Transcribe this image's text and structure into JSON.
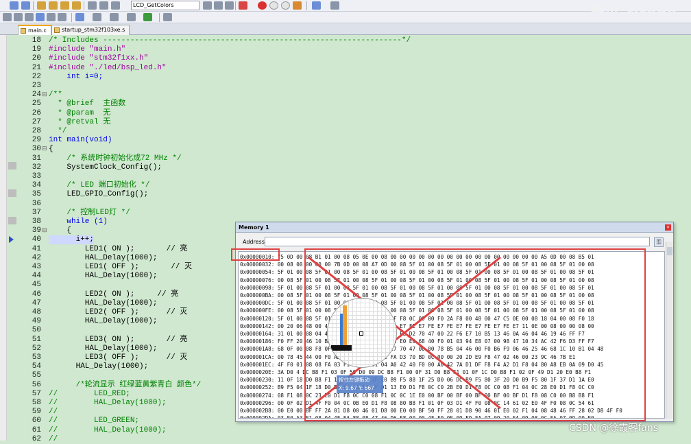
{
  "toolbar": {
    "function_select": "LCD_GetColors",
    "brand_text": "野火_firege"
  },
  "tabs": [
    {
      "label": "main.c",
      "active": true
    },
    {
      "label": "startup_stm32f103xe.s",
      "active": false
    }
  ],
  "editor": {
    "lines": [
      {
        "n": "18",
        "text": "/* Includes ------------------------------------------------------------------*/",
        "cls": "cm"
      },
      {
        "n": "19",
        "text": "#include \"main.h\"",
        "cls": "pp"
      },
      {
        "n": "20",
        "text": "#include \"stm32f1xx.h\"",
        "cls": "pp"
      },
      {
        "n": "21",
        "text": "#include \"./led/bsp_led.h\"",
        "cls": "pp"
      },
      {
        "n": "22",
        "text": "    int i=0;",
        "cls": "kw"
      },
      {
        "n": "23",
        "text": "",
        "cls": ""
      },
      {
        "n": "24",
        "text": "/**",
        "cls": "cm"
      },
      {
        "n": "25",
        "text": "  * @brief  主函数",
        "cls": "cm"
      },
      {
        "n": "26",
        "text": "  * @param  无",
        "cls": "cm"
      },
      {
        "n": "27",
        "text": "  * @retval 无",
        "cls": "cm"
      },
      {
        "n": "28",
        "text": "  */",
        "cls": "cm"
      },
      {
        "n": "29",
        "text": "int main(void)",
        "cls": "kw"
      },
      {
        "n": "30",
        "text": "{",
        "cls": ""
      },
      {
        "n": "31",
        "text": "    /* 系统时钟初始化成72 MHz */",
        "cls": "cm"
      },
      {
        "n": "32",
        "text": "    SystemClock_Config();",
        "cls": ""
      },
      {
        "n": "33",
        "text": "",
        "cls": ""
      },
      {
        "n": "34",
        "text": "    /* LED 端口初始化 */",
        "cls": "cm"
      },
      {
        "n": "35",
        "text": "    LED_GPIO_Config();",
        "cls": ""
      },
      {
        "n": "36",
        "text": "",
        "cls": ""
      },
      {
        "n": "37",
        "text": "    /* 控制LED灯 */",
        "cls": "cm"
      },
      {
        "n": "38",
        "text": "    while (1)",
        "cls": "kw"
      },
      {
        "n": "39",
        "text": "    {",
        "cls": ""
      },
      {
        "n": "40",
        "text": "      i++;",
        "cls": "cur"
      },
      {
        "n": "41",
        "text": "        LED1( ON );       // 亮",
        "cls": ""
      },
      {
        "n": "42",
        "text": "        HAL_Delay(1000);",
        "cls": ""
      },
      {
        "n": "43",
        "text": "        LED1( OFF );       // 灭",
        "cls": ""
      },
      {
        "n": "44",
        "text": "        HAL_Delay(1000);",
        "cls": ""
      },
      {
        "n": "45",
        "text": "",
        "cls": ""
      },
      {
        "n": "46",
        "text": "        LED2( ON );     // 亮",
        "cls": ""
      },
      {
        "n": "47",
        "text": "        HAL_Delay(1000);",
        "cls": ""
      },
      {
        "n": "48",
        "text": "        LED2( OFF );      // 灭",
        "cls": ""
      },
      {
        "n": "49",
        "text": "        HAL_Delay(1000);",
        "cls": ""
      },
      {
        "n": "50",
        "text": "",
        "cls": ""
      },
      {
        "n": "51",
        "text": "        LED3( ON );       // 亮",
        "cls": ""
      },
      {
        "n": "52",
        "text": "        HAL_Delay(1000);",
        "cls": ""
      },
      {
        "n": "53",
        "text": "        LED3( OFF );      // 灭",
        "cls": ""
      },
      {
        "n": "54",
        "text": "      HAL_Delay(1000);",
        "cls": ""
      },
      {
        "n": "55",
        "text": "",
        "cls": ""
      },
      {
        "n": "56",
        "text": "      /*轮流显示 红绿蓝黄紫青白 颜色*/",
        "cls": "cm"
      },
      {
        "n": "57",
        "text": "//        LED_RED;",
        "cls": "cm"
      },
      {
        "n": "58",
        "text": "//        HAL_Delay(1000);",
        "cls": "cm"
      },
      {
        "n": "59",
        "text": "//",
        "cls": "cm"
      },
      {
        "n": "60",
        "text": "//        LED_GREEN;",
        "cls": "cm"
      },
      {
        "n": "61",
        "text": "//        HAL_Delay(1000);",
        "cls": "cm"
      },
      {
        "n": "62",
        "text": "//",
        "cls": "cm"
      }
    ]
  },
  "memory": {
    "title": "Memory 1",
    "address_label": "Address:",
    "address_value": "",
    "rows": [
      "0x00000010: 75 0D 00 08 B1 01 00 08 05 0E 00 08 00 00 00 00 00 00 00 00 00 00 00 00 00 00 00 00 A5 0D 00 08 B5 01",
      "0x00000032: 00 08 00 00 00 00 7B 0D 00 08 A7 0D 00 08 5F 01 00 08 5F 01 00 08 5F 01 00 08 5F 01 00 08 5F 01 00 08",
      "0x00000054: 5F 01 00 08 5F 01 00 08 5F 01 00 08 5F 01 00 08 5F 01 00 08 5F 01 00 08 5F 01 00 08 5F 01 00 08 5F 01",
      "0x00000076: 00 08 5F 01 00 08 5F 01 00 08 5F 01 00 08 5F 01 00 08 5F 01 00 08 5F 01 00 08 5F 01 00 08 5F 01 00 08",
      "0x00000098: 5F 01 00 08 5F 01 00 08 5F 01 00 08 5F 01 00 08 5F 01 00 08 5F 01 00 08 5F 01 00 08 5F 01 00 08 5F 01",
      "0x000000BA: 00 08 5F 01 00 08 5F 01 00 08 5F 01 00 08 5F 01 00 08 5F 01 00 08 5F 01 00 08 5F 01 00 08 5F 01 00 08",
      "0x000000DC: 5F 01 00 08 5F 01 00 08 5F 01 00 08 5F 01 00 08 5F 01 00 08 5F 01 00 08 5F 01 00 08 5F 01 00 08 5F 01",
      "0x000000FE: 00 08 5F 01 00 08 5F 01 00 08 5F 01 00 08 5F 01 00 08 5F 01 00 08 5F 01 00 08 5F 01 00 08 5F 01 00 08",
      "0x00000120: 5F 01 00 08 5F 01 00 08 00 00 00 08 DF F8 0C 00 00 F0 2A F8 00 48 00 47 C5 0E 00 08 18 04 00 08 F0 18",
      "0x00000142: 00 20 06 48 00 47 FE E7 FE E7 FE E7 FE E7 FE E7 FE E7 FE E7 FE E7 FE E7 FE E7 11 0E 00 08 00 00 08 00",
      "0x00000164: 31 01 00 08 04 49 01 C9 10 1B 29 19 1E FE D2 70 47 00 22 F6 E7 10 B5 13 46 0A 46 04 46 19 46 FF F7",
      "0x00000186: F0 FF 20 46 10 BD 0C 47 1A E0 16 F8 06 E0 E0 68 40 F0 01 03 94 E8 07 00 98 47 10 34 AC 42 F6 D3 FF F7",
      "0x000001A8: 68 0F 00 08 F8 0F 00 08 43 1C 18 00 E7 70 47 00 00 78 B5 04 46 00 F0 B6 F9 06 46 25 46 68 1C 10 B1 04 48",
      "0x000001CA: 00 78 45 44 00 F0 AD F9 80 1B A8 42 FA D3 70 BD 0C 00 00 20 2D E9 F8 47 02 46 00 23 9C 46 7B E1",
      "0x000001EC: 4F F0 01 08 08 FA 03 F1 02 EA 01 04 A0 42 40 F0 00 A0 42 7A D1 DF F8 F4 A2 D1 F8 04 80 A8 EB 0A 09 D0 45",
      "0x0000020E: 3A D0 4 DC B8 F1 03 0F 50 D0 09 DC B8 F1 00 0F 31 D0 B8 F1 01 0F 1C D0 B8 F1 02 0F 49 D1 20 E0 B8 F1",
      "0x00000230: 11 0F 18 D0 B8 F1 12 0F 3E D1 1F E0 B9 F5 88 1F 25 D0 06 DC B9 F5 80 3F 20 D0 B9 F5 80 1F 37 D1 1A E0",
      "0x00000252: B9 F5 04 1F 18 D0 B9 F5 08 1F 2F D1 13 E0 D1 F8 0C C0 2B E0 D1 F8 0C C0 08 F1 04 0C 28 E0 D1 F8 0C C0",
      "0x00000274: 08 F1 08 0C 23 E0 D1 F8 0C C0 08 F1 0C 0C 1E E0 00 BF 00 BF 00 BF 00 BF 00 BF D1 F8 08 C0 00 B8 B8 F1",
      "0x00000296: 00 0F 02 D1 4F F0 04 0C 0B E0 D1 F8 08 80 B8 F1 01 0F 03 D1 4F F0 08 0C 14 61 02 E0 4F F0 08 0C 54 61",
      "0x000002B8: 00 E0 00 BF FF 2A 01 D8 00 46 01 D8 00 E0 00 BF 50 FF 28 01 D8 90 46 01 E0 02 F1 04 08 48 46 FF 28 02 D8 4F F0",
      "0x000002DA: 03 E0 A3 F1 08 04 4F EA 88 08 47 46 D6 F8 00 00 4F F0 0F 09 F9 FA 07 09 20 EA 09 08 0C FA 07 09 00 E0"
    ]
  },
  "zoom_tip": {
    "line1": "按住左键拖动",
    "line2": "X: 9.67  Y: 667"
  },
  "watermark": "CSDN @徐霞客fans"
}
